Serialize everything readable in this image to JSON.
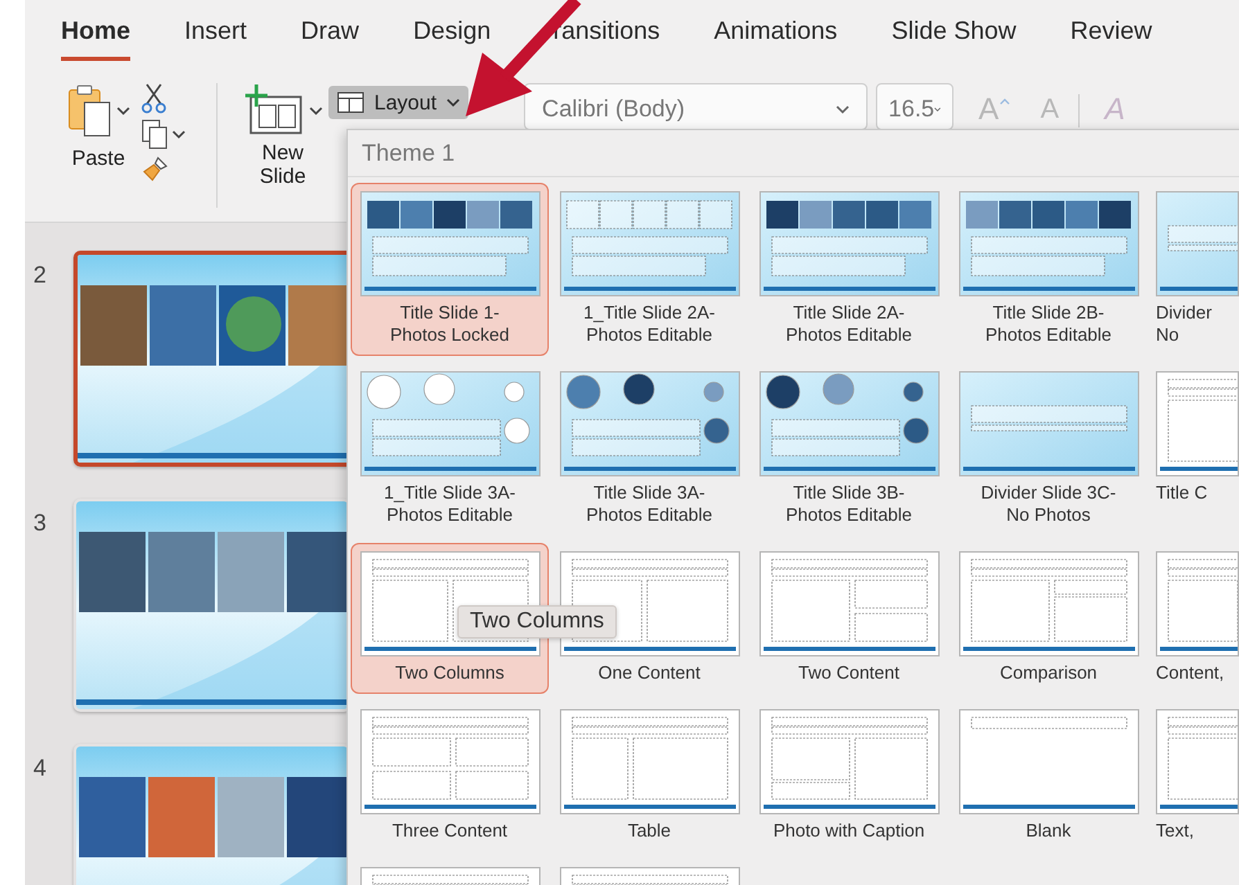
{
  "tabs": [
    {
      "label": "Home",
      "selected": true
    },
    {
      "label": "Insert",
      "selected": false
    },
    {
      "label": "Draw",
      "selected": false
    },
    {
      "label": "Design",
      "selected": false
    },
    {
      "label": "ransitions",
      "selected": false
    },
    {
      "label": "Animations",
      "selected": false
    },
    {
      "label": "Slide Show",
      "selected": false
    },
    {
      "label": "Review",
      "selected": false
    }
  ],
  "ribbon": {
    "paste": {
      "label": "Paste"
    },
    "new_slide": {
      "label": "New Slide"
    },
    "layout": {
      "label": "Layout",
      "expanded": true
    },
    "font": {
      "value": "Calibri (Body)"
    },
    "font_size": {
      "value": "16.5"
    },
    "grow_font": "A",
    "shrink_font": "A",
    "clear_formatting": "A"
  },
  "slides": [
    {
      "number": "2",
      "selected": true
    },
    {
      "number": "3",
      "selected": false
    },
    {
      "number": "4",
      "selected": false
    }
  ],
  "layout_gallery": {
    "heading": "Theme 1",
    "rows": [
      [
        {
          "label": "Title Slide 1-Photos Locked",
          "kind": "photo-strip",
          "selected": true
        },
        {
          "label": "1_Title Slide 2A-Photos Editable",
          "kind": "icon-strip",
          "selected": false
        },
        {
          "label": "Title Slide 2A-Photos Editable",
          "kind": "photo-strip",
          "selected": false
        },
        {
          "label": "Title Slide 2B-Photos Editable",
          "kind": "photo-strip",
          "selected": false
        },
        {
          "label": "Divider No",
          "kind": "divider",
          "selected": false
        }
      ],
      [
        {
          "label": "1_Title Slide 3A-Photos Editable",
          "kind": "icon-circles",
          "selected": false
        },
        {
          "label": "Title Slide 3A-Photos Editable",
          "kind": "photo-circles",
          "selected": false
        },
        {
          "label": "Title Slide 3B-Photos Editable",
          "kind": "photo-circles",
          "selected": false
        },
        {
          "label": "Divider Slide 3C-No Photos",
          "kind": "divider",
          "selected": false
        },
        {
          "label": "Title C",
          "kind": "title-content",
          "selected": false
        }
      ],
      [
        {
          "label": "Two Columns",
          "kind": "two-columns",
          "selected": true
        },
        {
          "label": "One Content",
          "kind": "one-content",
          "selected": false
        },
        {
          "label": "Two Content",
          "kind": "two-content",
          "selected": false
        },
        {
          "label": "Comparison",
          "kind": "comparison",
          "selected": false
        },
        {
          "label": "Content,",
          "kind": "one-content",
          "selected": false
        }
      ],
      [
        {
          "label": "Three Content",
          "kind": "three-content",
          "selected": false
        },
        {
          "label": "Table",
          "kind": "table",
          "selected": false
        },
        {
          "label": "Photo with Caption",
          "kind": "photo-caption",
          "selected": false
        },
        {
          "label": "Blank",
          "kind": "blank",
          "selected": false
        },
        {
          "label": "Text,",
          "kind": "title-content",
          "selected": false
        }
      ],
      [
        {
          "kind": "title-content",
          "selected": false
        },
        {
          "kind": "table",
          "selected": false
        }
      ]
    ]
  },
  "tooltip": "Two Columns"
}
